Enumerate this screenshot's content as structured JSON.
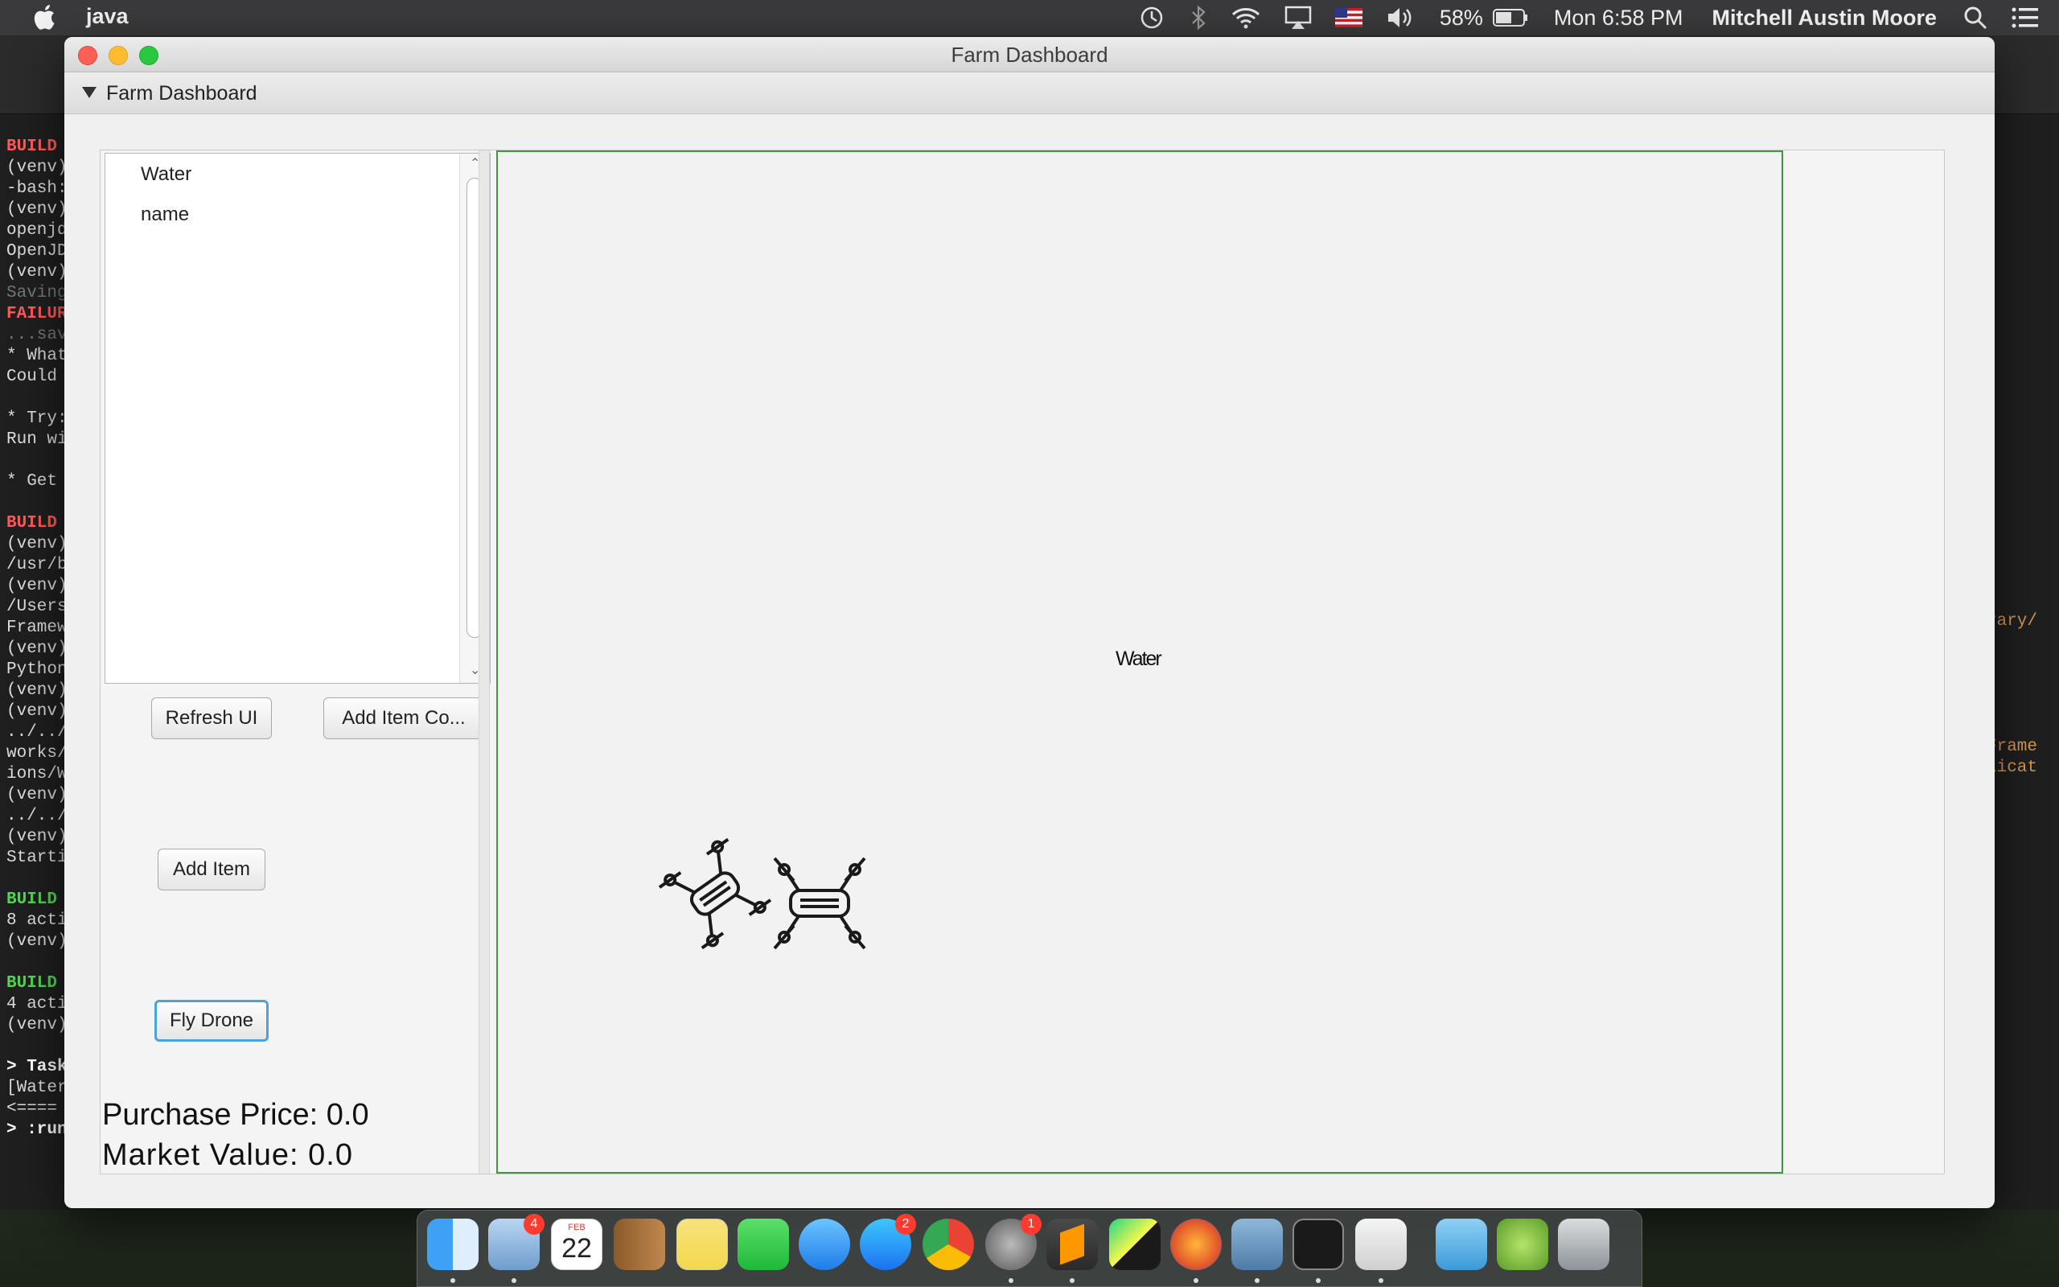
{
  "menubar": {
    "app_name": "java",
    "battery": "58%",
    "clock": "Mon 6:58 PM",
    "user": "Mitchell Austin Moore"
  },
  "window": {
    "title": "Farm Dashboard",
    "pane_title": "Farm Dashboard"
  },
  "item_list": {
    "items": [
      "Water",
      "name"
    ]
  },
  "buttons": {
    "refresh": "Refresh UI",
    "add_item_co": "Add Item Co...",
    "add_item": "Add Item",
    "fly_drone": "Fly Drone"
  },
  "prices": {
    "purchase": "Purchase Price: 0.0",
    "market": "Market Value:  0.0"
  },
  "canvas": {
    "label": "Water"
  },
  "terminal": {
    "lines": [
      "BUILD",
      "(venv)",
      "-bash:",
      "(venv)",
      "openjd",
      "OpenJD",
      "(venv)",
      "Saving",
      "FAILUR",
      "...sav",
      "* What",
      "Could",
      "",
      "* Try:",
      "Run wi",
      "",
      "* Get",
      "",
      "BUILD",
      "(venv)",
      "/usr/b",
      "(venv)",
      "/Users",
      "Framew",
      "(venv)",
      "Python",
      "(venv)",
      "(venv)",
      "../../",
      "works/",
      "ions/W",
      "(venv)",
      "../../",
      "(venv)",
      "Starti",
      "",
      "BUILD",
      "8 acti",
      "(venv)",
      "",
      "BUILD",
      "4 acti",
      "(venv)",
      "",
      "> Task",
      "[Water",
      "<====",
      "> :run"
    ],
    "right_lines": [
      "rary/",
      "",
      "",
      "",
      "",
      "",
      "Frame",
      "licat"
    ]
  },
  "dock": {
    "badges": {
      "mail": "4",
      "appstore": "2",
      "prefs": "1"
    },
    "calendar_month": "FEB",
    "calendar_day": "22"
  },
  "colors": {
    "canvas_border": "#3c9a3c",
    "fly_focus": "#4ba3d9"
  }
}
